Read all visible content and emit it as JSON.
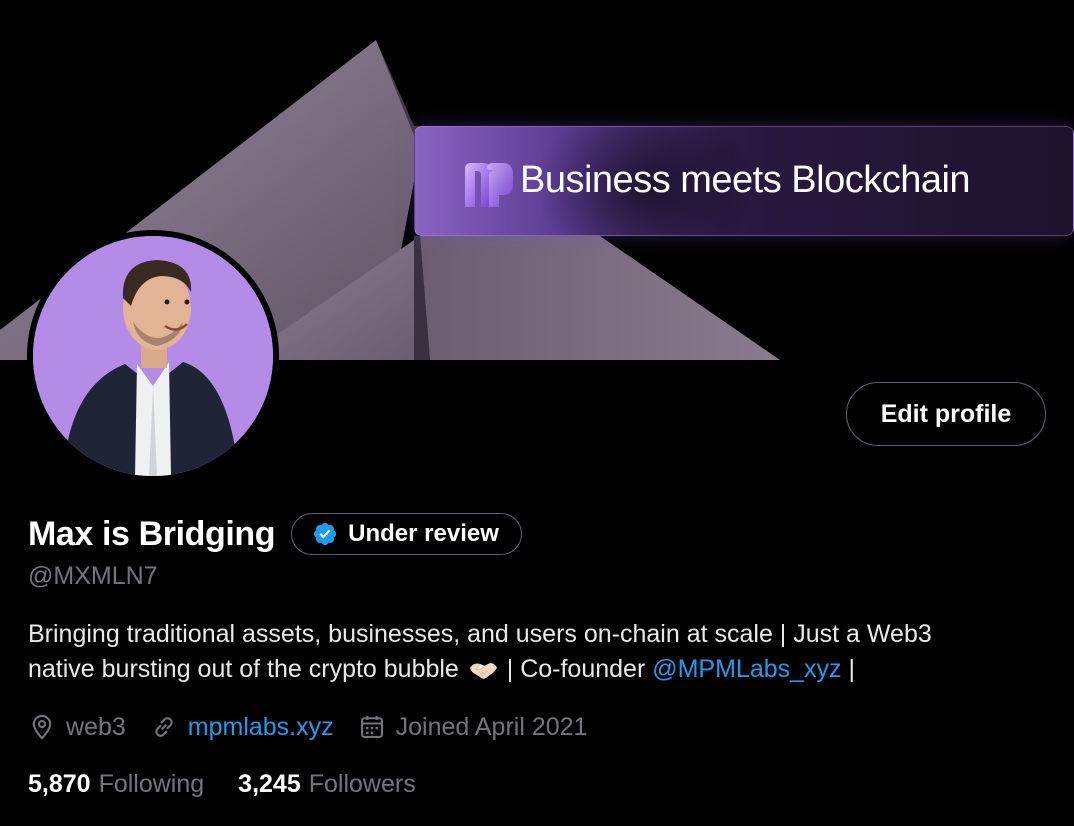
{
  "banner": {
    "headline": "Business meets Blockchain",
    "logo_icon": "mpm-logo-icon",
    "accent": "#7b4fc8"
  },
  "profile": {
    "avatar_icon": "profile-photo",
    "display_name": "Max is Bridging",
    "verification_label": "Under review",
    "verification_icon": "verified-check-icon",
    "handle": "@MXMLN7",
    "edit_button_label": "Edit profile"
  },
  "bio": {
    "line1": "Bringing traditional assets, businesses, and users on-chain at scale | Just a Web3",
    "line2_before": "native bursting out of the crypto bubble",
    "line2_emoji": "handshake-emoji",
    "line2_middle": "| Co-founder",
    "mention": "@MPMLabs_xyz",
    "line2_after": "|"
  },
  "meta": {
    "location": "web3",
    "location_icon": "location-pin-icon",
    "website": "mpmlabs.xyz",
    "website_icon": "link-icon",
    "joined": "Joined April 2021",
    "joined_icon": "calendar-icon"
  },
  "stats": {
    "following_count": "5,870",
    "following_label": "Following",
    "followers_count": "3,245",
    "followers_label": "Followers"
  },
  "colors": {
    "background": "#000000",
    "text_primary": "#e7e9ea",
    "text_secondary": "#71767b",
    "link": "#1d9bf0",
    "border": "#536471",
    "verified_blue": "#1d9bf0"
  }
}
